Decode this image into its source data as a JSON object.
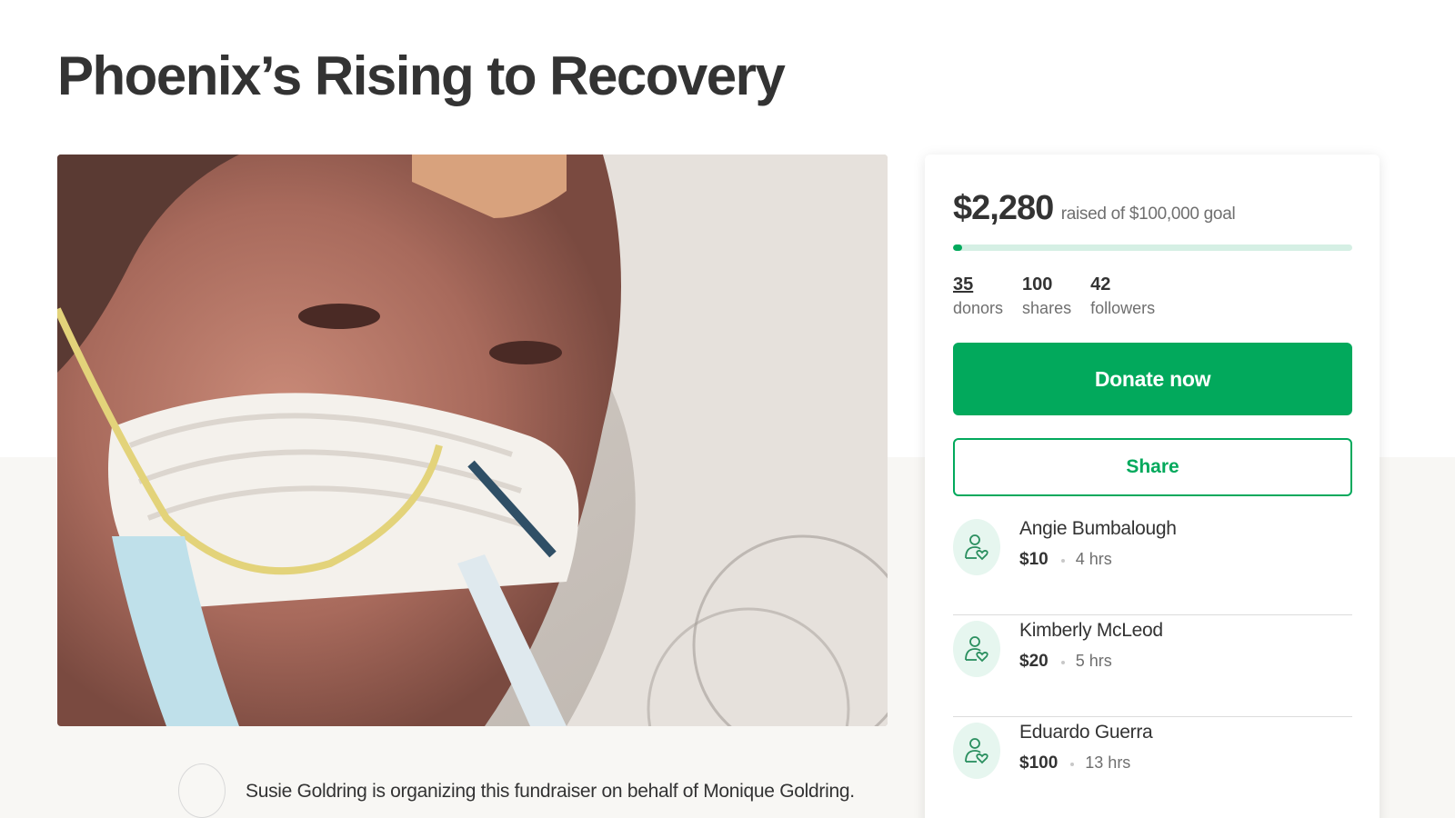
{
  "campaign": {
    "title": "Phoenix’s Rising to Recovery",
    "organizer_text": "Susie Goldring is organizing this fundraiser on behalf of Monique Goldring."
  },
  "funding": {
    "raised": "$2,280",
    "goal_text": "raised of $100,000 goal",
    "progress_fraction": 0.0228
  },
  "stats": [
    {
      "value": "35",
      "label": "donors"
    },
    {
      "value": "100",
      "label": "shares"
    },
    {
      "value": "42",
      "label": "followers"
    }
  ],
  "buttons": {
    "donate": "Donate now",
    "share": "Share"
  },
  "donations": [
    {
      "name": "Angie Bumbalough",
      "amount": "$10",
      "time": "4 hrs"
    },
    {
      "name": "Kimberly McLeod",
      "amount": "$20",
      "time": "5 hrs"
    },
    {
      "name": "Eduardo Guerra",
      "amount": "$100",
      "time": "13 hrs"
    }
  ],
  "icons": {
    "donor": "donor-heart-icon",
    "organizer": "organizer-avatar"
  },
  "colors": {
    "brand_green": "#02a95c",
    "progress_track": "#d5efe4",
    "icon_bg": "#e6f6ef",
    "text": "#333333",
    "muted": "#6f6f6f",
    "lower_bg": "#f8f7f4"
  }
}
